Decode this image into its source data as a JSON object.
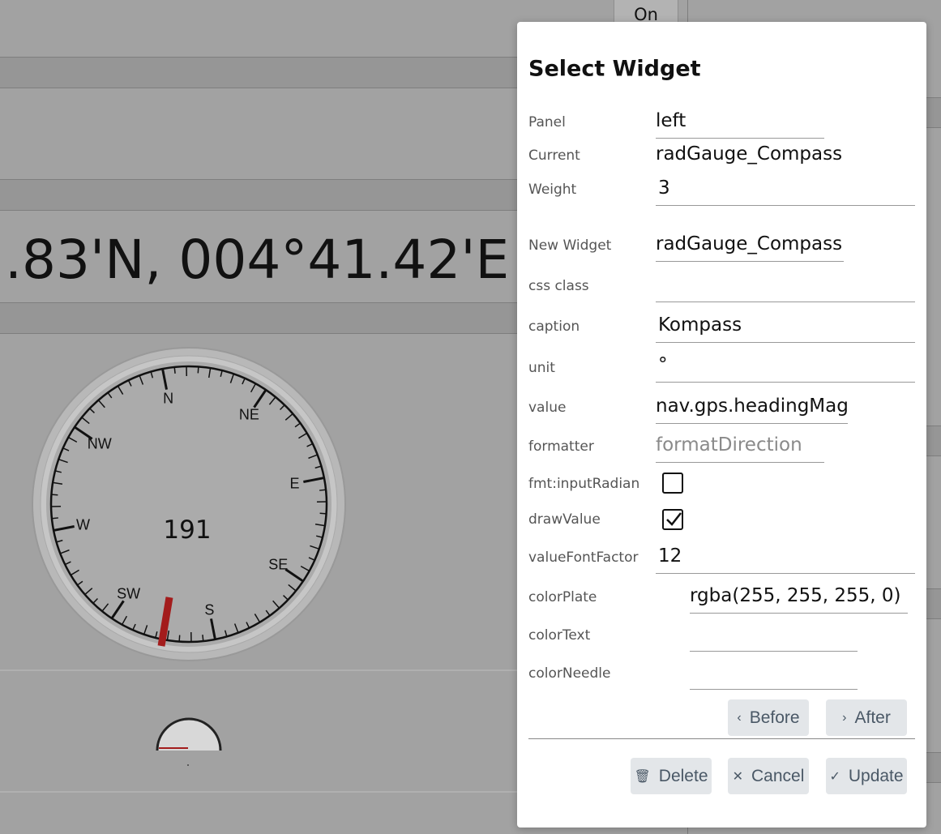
{
  "background": {
    "on_button": "On",
    "position": ".83'N, 004°41.42'E",
    "compass": {
      "value": "191",
      "labels": [
        "S",
        "SW",
        "W",
        "NW",
        "N",
        "NE",
        "E",
        "SE"
      ]
    }
  },
  "dialog": {
    "title": "Select Widget",
    "fields": {
      "panel": {
        "label": "Panel",
        "value": "left"
      },
      "current": {
        "label": "Current",
        "value": "radGauge_Compass"
      },
      "weight": {
        "label": "Weight",
        "value": "3"
      },
      "new_widget": {
        "label": "New Widget",
        "value": "radGauge_Compass"
      },
      "css_class": {
        "label": "css class",
        "value": ""
      },
      "caption": {
        "label": "caption",
        "value": "Kompass"
      },
      "unit": {
        "label": "unit",
        "value": "°"
      },
      "value": {
        "label": "value",
        "value": "nav.gps.headingMag"
      },
      "formatter": {
        "label": "formatter",
        "placeholder": "formatDirection"
      },
      "fmt_input_radian": {
        "label": "fmt:inputRadian",
        "checked": false
      },
      "draw_value": {
        "label": "drawValue",
        "checked": true
      },
      "value_font_factor": {
        "label": "valueFontFactor",
        "value": "12"
      },
      "color_plate": {
        "label": "colorPlate",
        "value": "rgba(255, 255, 255, 0)"
      },
      "color_text": {
        "label": "colorText",
        "value": ""
      },
      "color_needle": {
        "label": "colorNeedle",
        "value": ""
      }
    },
    "buttons": {
      "before": "Before",
      "after": "After",
      "delete": "Delete",
      "cancel": "Cancel",
      "update": "Update"
    },
    "icons": {
      "before": "chevron-left-icon",
      "after": "chevron-right-icon",
      "delete": "trash-icon",
      "cancel": "close-icon",
      "update": "check-icon"
    }
  }
}
